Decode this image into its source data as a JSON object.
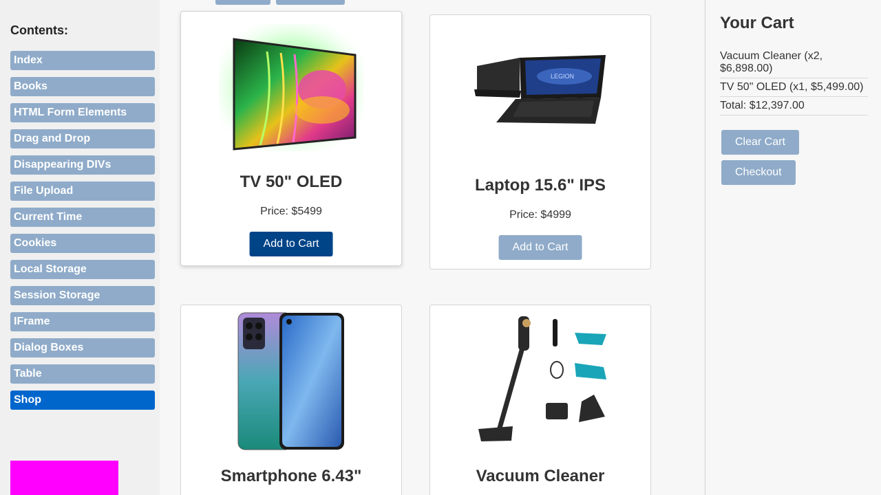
{
  "sidebar": {
    "title": "Contents:",
    "items": [
      {
        "label": "Index"
      },
      {
        "label": "Books"
      },
      {
        "label": "HTML Form Elements"
      },
      {
        "label": "Drag and Drop"
      },
      {
        "label": "Disappearing DIVs"
      },
      {
        "label": "File Upload"
      },
      {
        "label": "Current Time"
      },
      {
        "label": "Cookies"
      },
      {
        "label": "Local Storage"
      },
      {
        "label": "Session Storage"
      },
      {
        "label": "IFrame"
      },
      {
        "label": "Dialog Boxes"
      },
      {
        "label": "Table"
      },
      {
        "label": "Shop",
        "active": true
      }
    ],
    "accent_color": "#ff00ff"
  },
  "products": [
    {
      "name": "TV 50\" OLED",
      "price": "Price: $5499",
      "button": "Add to Cart"
    },
    {
      "name": "Laptop 15.6\" IPS",
      "price": "Price: $4999",
      "button": "Add to Cart"
    },
    {
      "name": "Smartphone 6.43\""
    },
    {
      "name": "Vacuum Cleaner"
    }
  ],
  "cart": {
    "title": "Your Cart",
    "items": [
      "Vacuum Cleaner (x2, $6,898.00)",
      "TV 50\" OLED (x1, $5,499.00)",
      "Total: $12,397.00"
    ],
    "clear_label": "Clear Cart",
    "checkout_label": "Checkout"
  },
  "colors": {
    "nav_bg": "#8fabc9",
    "nav_active": "#0066cc",
    "button_dark": "#004488"
  }
}
